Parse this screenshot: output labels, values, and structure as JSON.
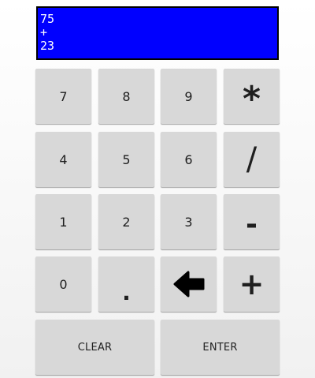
{
  "display": {
    "lines": [
      "75",
      "+",
      "23"
    ],
    "background": "#0000ff",
    "text_color": "#ffffff"
  },
  "keypad": {
    "row1": [
      "7",
      "8",
      "9",
      "*"
    ],
    "row2": [
      "4",
      "5",
      "6",
      "/"
    ],
    "row3": [
      "1",
      "2",
      "3",
      "-"
    ],
    "row4": [
      "0",
      ".",
      "+"
    ],
    "backspace_icon": "arrow-left-icon",
    "clear_label": "CLEAR",
    "enter_label": "ENTER",
    "key_color": "#d8d8d8"
  }
}
